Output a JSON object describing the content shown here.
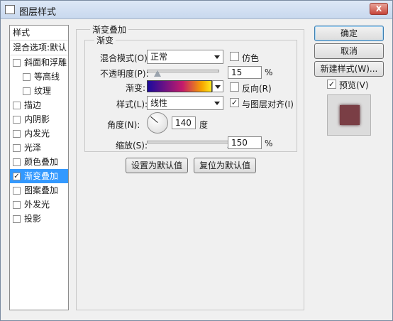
{
  "window": {
    "title": "图层样式",
    "close_label": "X"
  },
  "sidebar": {
    "header": "样式",
    "blend_options": "混合选项:默认",
    "items": [
      {
        "label": "斜面和浮雕",
        "checked": false,
        "indent": false
      },
      {
        "label": "等高线",
        "checked": false,
        "indent": true
      },
      {
        "label": "纹理",
        "checked": false,
        "indent": true
      },
      {
        "label": "描边",
        "checked": false,
        "indent": false
      },
      {
        "label": "内阴影",
        "checked": false,
        "indent": false
      },
      {
        "label": "内发光",
        "checked": false,
        "indent": false
      },
      {
        "label": "光泽",
        "checked": false,
        "indent": false
      },
      {
        "label": "颜色叠加",
        "checked": false,
        "indent": false
      },
      {
        "label": "渐变叠加",
        "checked": true,
        "indent": false,
        "selected": true
      },
      {
        "label": "图案叠加",
        "checked": false,
        "indent": false
      },
      {
        "label": "外发光",
        "checked": false,
        "indent": false
      },
      {
        "label": "投影",
        "checked": false,
        "indent": false
      }
    ]
  },
  "panel": {
    "section_title": "渐变叠加",
    "group_title": "渐变",
    "blend_mode_label": "混合模式(O):",
    "blend_mode_value": "正常",
    "dither_label": "仿色",
    "dither_checked": false,
    "opacity_label": "不透明度(P):",
    "opacity_value": "15",
    "opacity_unit": "%",
    "opacity_level": 0.15,
    "gradient_label": "渐变:",
    "reverse_label": "反向(R)",
    "reverse_checked": false,
    "style_label": "样式(L):",
    "style_value": "线性",
    "align_label": "与图层对齐(I)",
    "align_checked": true,
    "angle_label": "角度(N):",
    "angle_value": "140",
    "angle_unit": "度",
    "scale_label": "缩放(S):",
    "scale_value": "150",
    "scale_unit": "%",
    "scale_level": 1.0,
    "set_default_label": "设置为默认值",
    "reset_default_label": "复位为默认值",
    "gradient_colors": [
      "#1a0a9c",
      "#c41b6b",
      "#f7a400",
      "#ffe91e"
    ]
  },
  "actions": {
    "ok": "确定",
    "cancel": "取消",
    "new_style": "新建样式(W)...",
    "preview_label": "预览(V)",
    "preview_checked": true,
    "preview_color": "#7a3e45"
  }
}
